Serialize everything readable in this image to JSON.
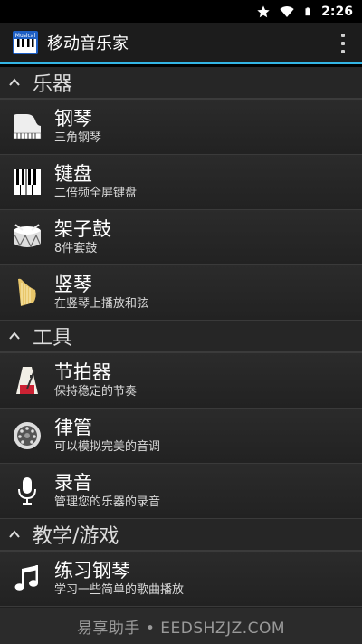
{
  "status_bar": {
    "time": "2:26",
    "icons": [
      "star-icon",
      "wifi-icon",
      "battery-icon"
    ]
  },
  "action_bar": {
    "title": "移动音乐家",
    "app_icon_text": "Musical"
  },
  "sections": [
    {
      "label": "乐器",
      "items": [
        {
          "title": "钢琴",
          "subtitle": "三角钢琴",
          "icon": "grand-piano-icon"
        },
        {
          "title": "键盘",
          "subtitle": "二倍频全屏键盘",
          "icon": "keyboard-icon"
        },
        {
          "title": "架子鼓",
          "subtitle": "8件套鼓",
          "icon": "drum-icon"
        },
        {
          "title": "竖琴",
          "subtitle": "在竖琴上播放和弦",
          "icon": "harp-icon"
        }
      ]
    },
    {
      "label": "工具",
      "items": [
        {
          "title": "节拍器",
          "subtitle": "保持稳定的节奏",
          "icon": "metronome-icon"
        },
        {
          "title": "律管",
          "subtitle": "可以模拟完美的音调",
          "icon": "pitch-pipe-icon"
        },
        {
          "title": "录音",
          "subtitle": "管理您的乐器的录音",
          "icon": "microphone-icon"
        }
      ]
    },
    {
      "label": "教学/游戏",
      "items": [
        {
          "title": "练习钢琴",
          "subtitle": "学习一些简单的歌曲播放",
          "icon": "music-note-icon"
        }
      ]
    }
  ],
  "footer": {
    "watermark": "易享助手 • EEDSHZJZ.COM"
  },
  "colors": {
    "accent": "#33b5e5",
    "background": "#222222"
  }
}
